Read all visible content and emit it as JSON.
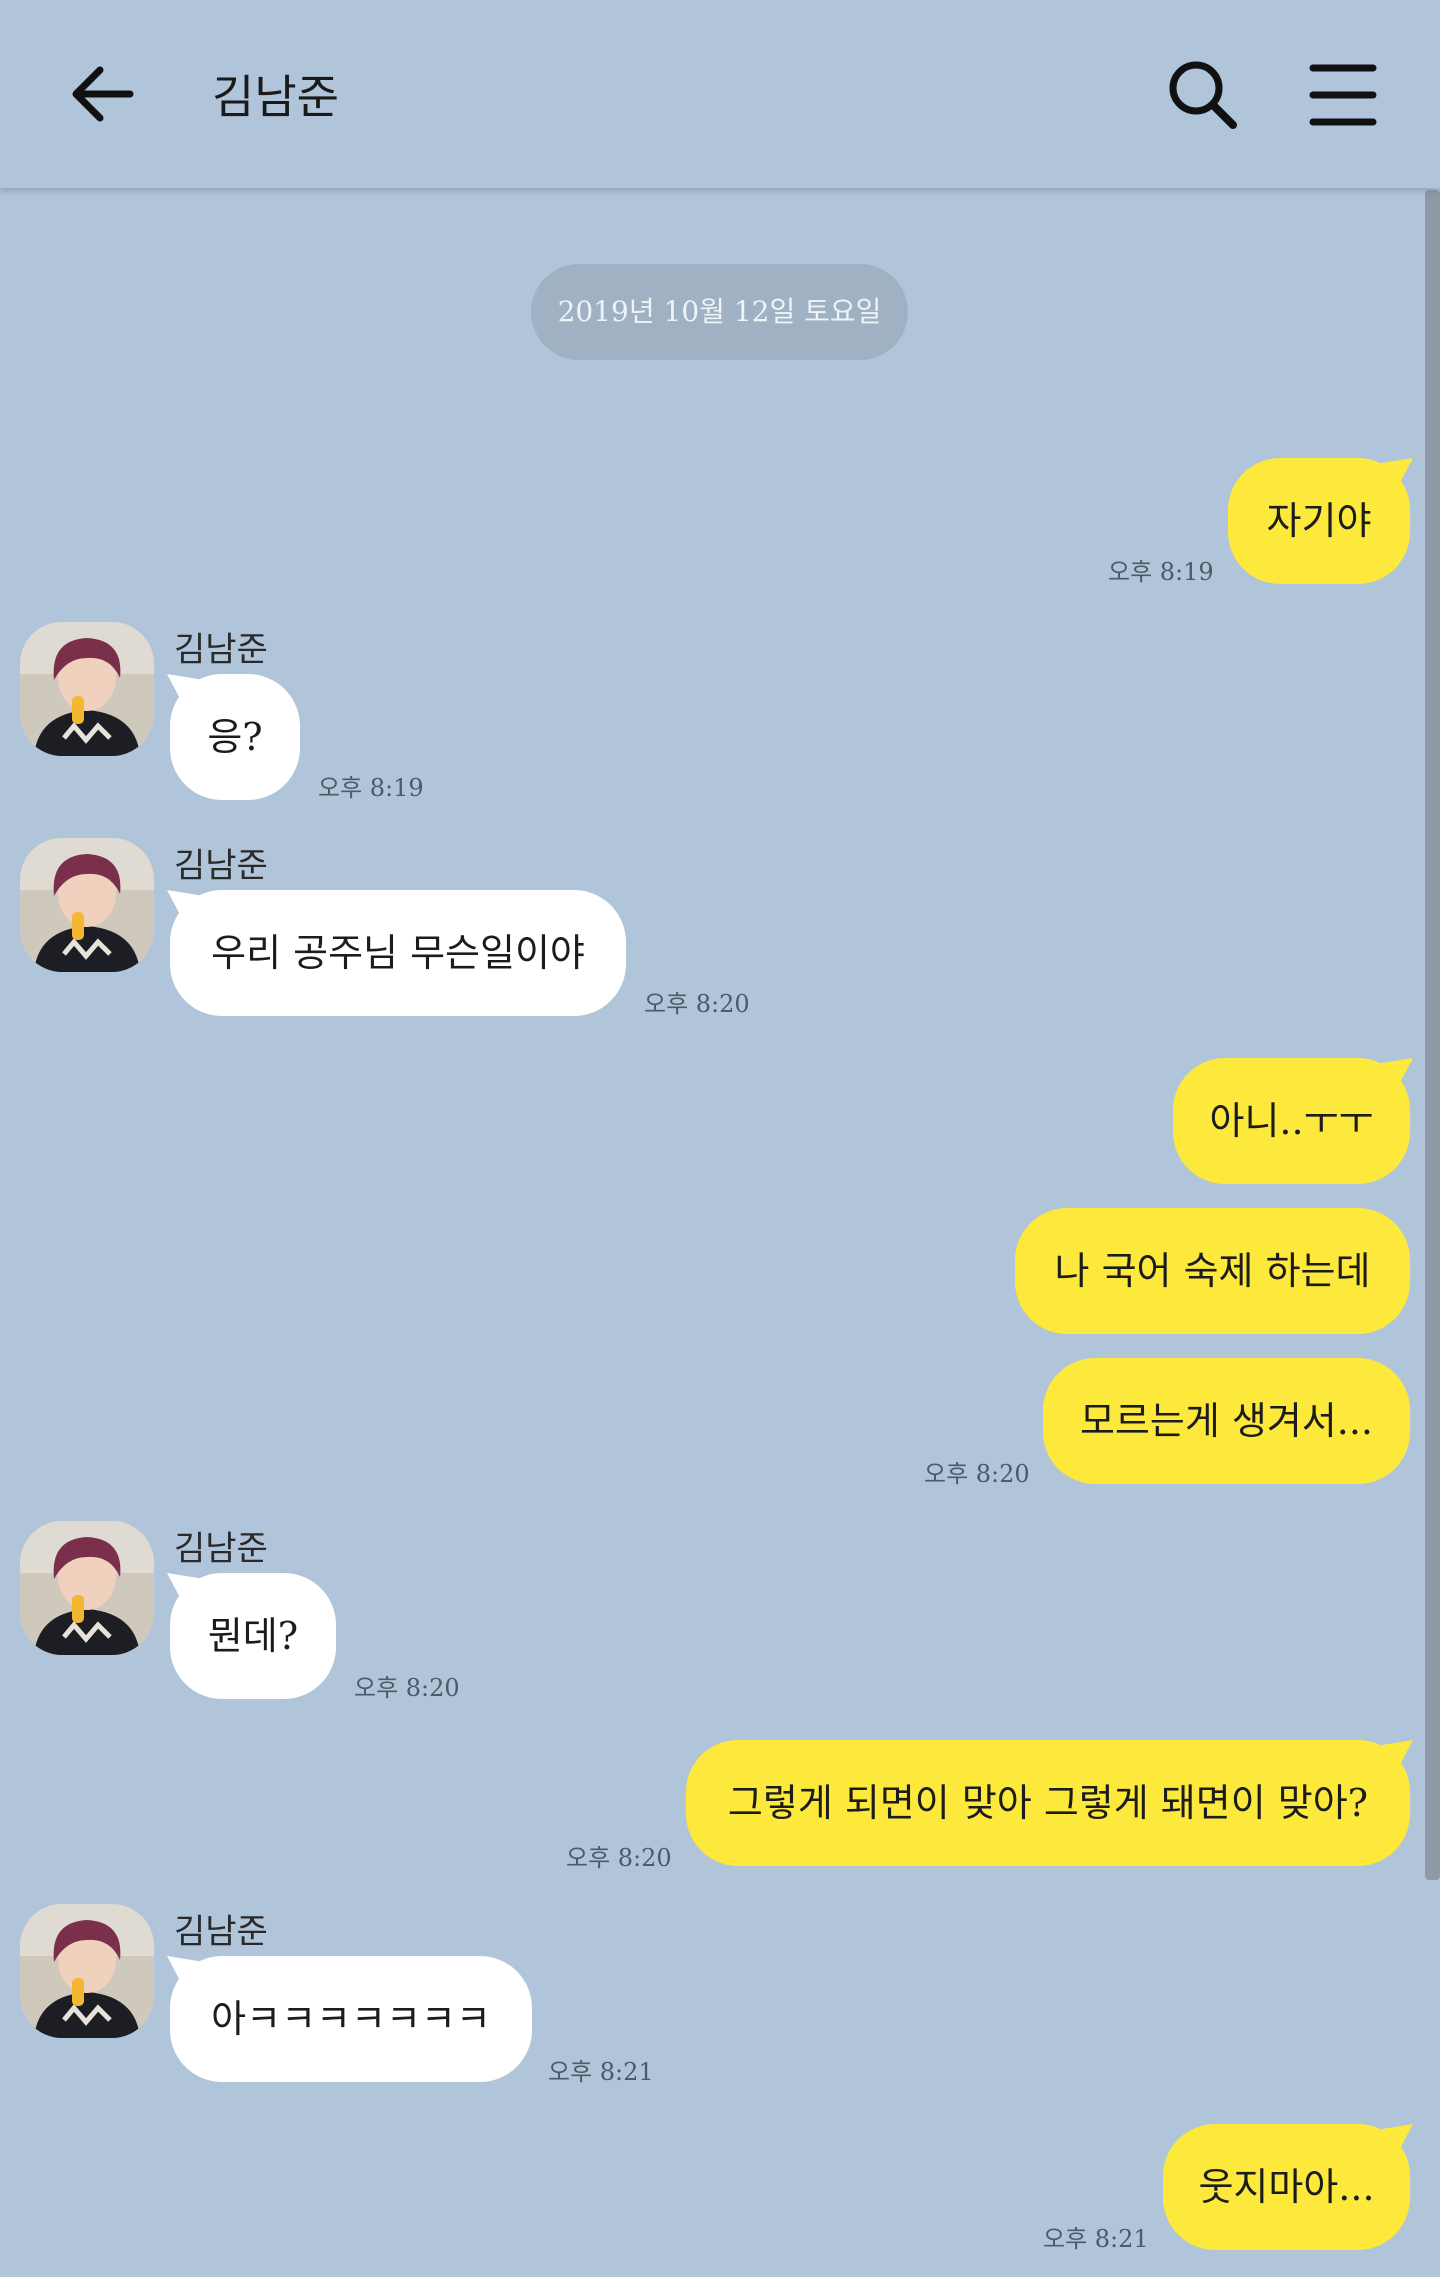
{
  "header": {
    "title": "김남준",
    "back_icon": "arrow-left-icon",
    "search_icon": "search-icon",
    "menu_icon": "hamburger-menu-icon"
  },
  "date_divider": "2019년 10월 12일 토요일",
  "colors": {
    "background": "#b0c5d9",
    "my_bubble": "#fde93b",
    "their_bubble": "#ffffff",
    "date_pill": "#9fb1c3"
  },
  "messages": [
    {
      "from": "me",
      "text": "자기야",
      "time": "오후 8:19"
    },
    {
      "from": "them",
      "sender": "김남준",
      "text": "응?",
      "time": "오후 8:19"
    },
    {
      "from": "them",
      "sender": "김남준",
      "text": "우리 공주님 무슨일이야",
      "time": "오후 8:20"
    },
    {
      "from": "me",
      "text": "아니..ㅜㅜ",
      "time": ""
    },
    {
      "from": "me",
      "text": "나 국어 숙제 하는데",
      "time": ""
    },
    {
      "from": "me",
      "text": "모르는게 생겨서...",
      "time": "오후 8:20"
    },
    {
      "from": "them",
      "sender": "김남준",
      "text": "뭔데?",
      "time": "오후 8:20"
    },
    {
      "from": "me",
      "text": "그렇게 되면이 맞아 그렇게 돼면이 맞아?",
      "time": "오후 8:20"
    },
    {
      "from": "them",
      "sender": "김남준",
      "text": "아ㅋㅋㅋㅋㅋㅋㅋ",
      "time": "오후 8:21"
    },
    {
      "from": "me",
      "text": "웃지마아...",
      "time": "오후 8:21"
    }
  ]
}
